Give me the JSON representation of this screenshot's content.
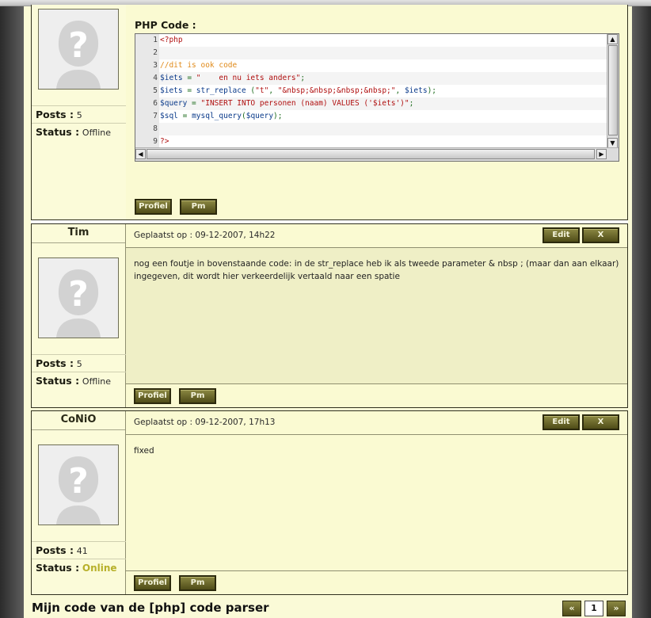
{
  "code_block": {
    "title": "PHP Code :",
    "lines": [
      {
        "n": "1",
        "parts": [
          {
            "t": "<?php",
            "c": "tk-php"
          }
        ]
      },
      {
        "n": "2",
        "parts": []
      },
      {
        "n": "3",
        "parts": [
          {
            "t": "//dit is ook code",
            "c": "tk-com"
          }
        ]
      },
      {
        "n": "4",
        "parts": [
          {
            "t": "$iets",
            "c": "tk-var"
          },
          {
            "t": " = ",
            "c": "tk-op"
          },
          {
            "t": "\"    en nu iets anders\"",
            "c": "tk-str"
          },
          {
            "t": ";",
            "c": "tk-op"
          }
        ]
      },
      {
        "n": "5",
        "parts": [
          {
            "t": "$iets",
            "c": "tk-var"
          },
          {
            "t": " = ",
            "c": "tk-op"
          },
          {
            "t": "str_replace",
            "c": "tk-fn"
          },
          {
            "t": " (",
            "c": "tk-op"
          },
          {
            "t": "\"t\"",
            "c": "tk-str"
          },
          {
            "t": ", ",
            "c": "tk-op"
          },
          {
            "t": "\"&nbsp;&nbsp;&nbsp;&nbsp;\"",
            "c": "tk-str"
          },
          {
            "t": ", ",
            "c": "tk-op"
          },
          {
            "t": "$iets",
            "c": "tk-var"
          },
          {
            "t": ");",
            "c": "tk-op"
          }
        ]
      },
      {
        "n": "6",
        "parts": [
          {
            "t": "$query",
            "c": "tk-var"
          },
          {
            "t": " = ",
            "c": "tk-op"
          },
          {
            "t": "\"INSERT INTO personen (naam) VALUES ('$iets')\"",
            "c": "tk-str"
          },
          {
            "t": ";",
            "c": "tk-op"
          }
        ]
      },
      {
        "n": "7",
        "parts": [
          {
            "t": "$sql",
            "c": "tk-var"
          },
          {
            "t": " = ",
            "c": "tk-op"
          },
          {
            "t": "mysql_query",
            "c": "tk-fn"
          },
          {
            "t": "(",
            "c": "tk-op"
          },
          {
            "t": "$query",
            "c": "tk-var"
          },
          {
            "t": ");",
            "c": "tk-op"
          }
        ]
      },
      {
        "n": "8",
        "parts": []
      },
      {
        "n": "9",
        "parts": [
          {
            "t": "?>",
            "c": "tk-php"
          }
        ]
      }
    ]
  },
  "labels": {
    "posts": "Posts :",
    "status": "Status :",
    "profile": "Profiel",
    "pm": "Pm",
    "edit": "Edit",
    "delete": "X"
  },
  "posts": [
    {
      "user": "",
      "posts": "5",
      "status": "Offline",
      "posted": "",
      "body": ""
    },
    {
      "user": "Tim",
      "posts": "5",
      "status": "Offline",
      "posted": "Geplaatst op : 09-12-2007, 14h22",
      "body": "nog een foutje in bovenstaande code: in de str_replace heb ik als tweede parameter & nbsp ; (maar dan aan elkaar) ingegeven, dit wordt hier verkeerdelijk vertaald naar een spatie"
    },
    {
      "user": "CoNiO",
      "posts": "41",
      "status": "Online",
      "posted": "Geplaatst op : 09-12-2007, 17h13",
      "body": "fixed"
    }
  ],
  "thread": {
    "title": "Mijn code van de [php] code parser",
    "pager": {
      "prev": "«",
      "current": "1",
      "next": "»"
    }
  },
  "colors": {
    "accent": "#6e6a2c",
    "online": "#b7b02a",
    "panel": "#fafad2"
  }
}
